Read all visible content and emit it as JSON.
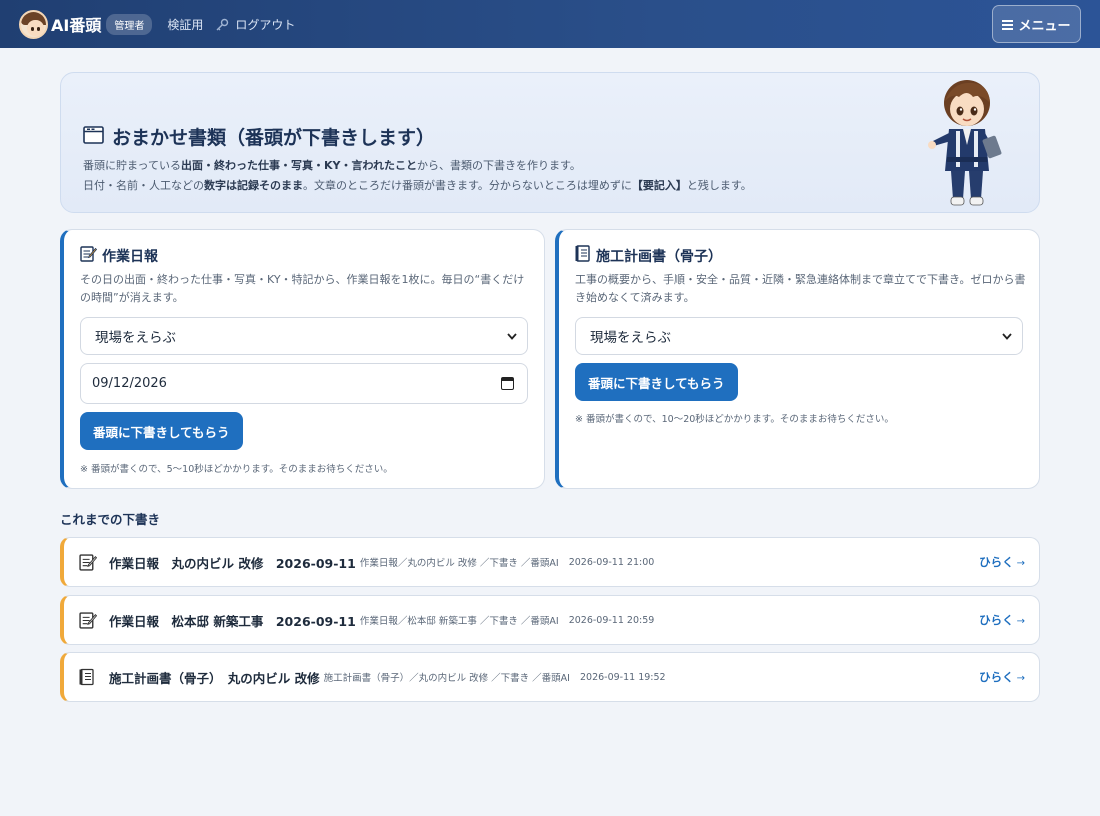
{
  "header": {
    "brand": "AI番頭",
    "role_badge": "管理者",
    "nav_verify": "検証用",
    "nav_logout": "ログアウト",
    "menu_label": "メニュー"
  },
  "hero": {
    "title": "おまかせ書類（番頭が下書きします）",
    "desc1_a": "番頭に貯まっている",
    "desc1_b": "出面・終わった仕事・写真・KY・言われたこと",
    "desc1_c": "から、書類の下書きを作ります。",
    "desc2_a": "日付・名前・人工などの",
    "desc2_b": "数字は記録そのまま",
    "desc2_c": "。文章のところだけ番頭が書きます。分からないところは埋めずに",
    "desc2_d": "【要記入】",
    "desc2_e": "と残します。"
  },
  "daily_report": {
    "title": "作業日報",
    "desc": "その日の出面・終わった仕事・写真・KY・特記から、作業日報を1枚に。毎日の“書くだけの時間”が消えます。",
    "site_select": "現場をえらぶ",
    "date_value": "09/12/2026",
    "button": "番頭に下書きしてもらう",
    "note": "※ 番頭が書くので、5〜10秒ほどかかります。そのままお待ちください。"
  },
  "construction_plan": {
    "title": "施工計画書（骨子）",
    "desc": "工事の概要から、手順・安全・品質・近隣・緊急連絡体制まで章立てで下書き。ゼロから書き始めなくて済みます。",
    "site_select": "現場をえらぶ",
    "button": "番頭に下書きしてもらう",
    "note": "※ 番頭が書くので、10〜20秒ほどかかります。そのままお待ちください。"
  },
  "history": {
    "title": "これまでの下書き",
    "open_label": "ひらく",
    "arrow": "→",
    "items": [
      {
        "icon": "memo-icon",
        "title": "作業日報　丸の内ビル 改修　2026-09-11",
        "meta": "作業日報／丸の内ビル 改修 ／下書き ／番頭AI",
        "time": "2026-09-11 21:00"
      },
      {
        "icon": "memo-icon",
        "title": "作業日報　松本邸 新築工事　2026-09-11",
        "meta": "作業日報／松本邸 新築工事 ／下書き ／番頭AI",
        "time": "2026-09-11 20:59"
      },
      {
        "icon": "notebook-icon",
        "title": "施工計画書（骨子）　丸の内ビル 改修",
        "meta": "施工計画書（骨子）／丸の内ビル 改修 ／下書き ／番頭AI",
        "time": "2026-09-11 19:52"
      }
    ]
  }
}
